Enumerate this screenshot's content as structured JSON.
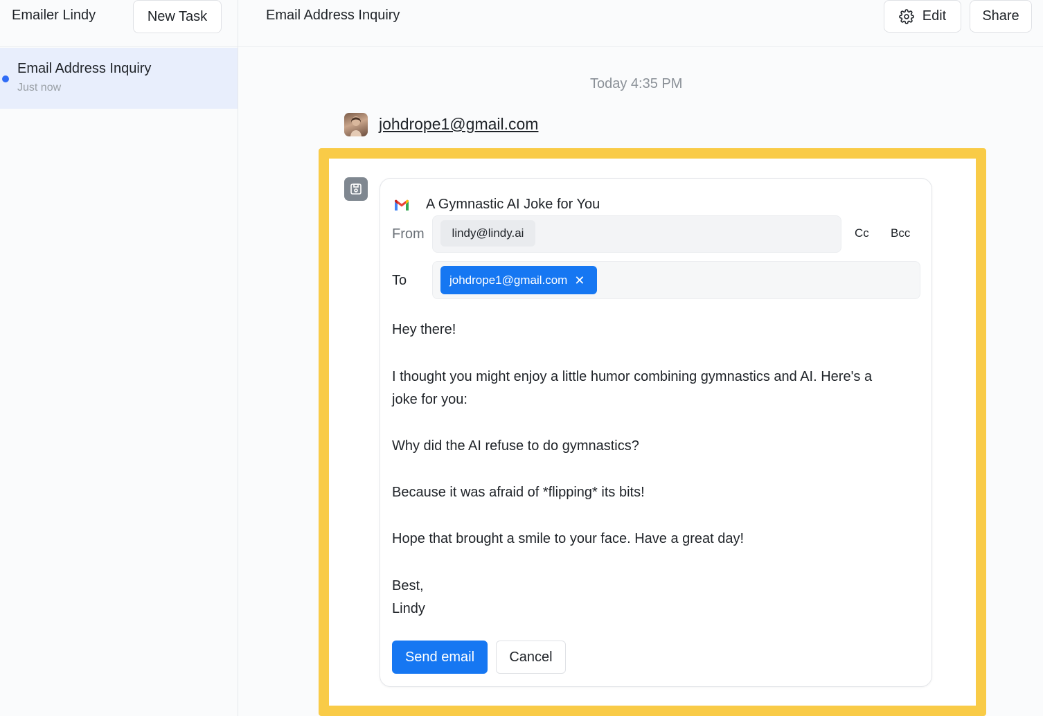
{
  "sidebar": {
    "app_name": "Emailer Lindy",
    "new_task_label": "New Task",
    "tasks": [
      {
        "title": "Email Address Inquiry",
        "subtitle": "Just now"
      }
    ]
  },
  "header": {
    "title": "Email Address Inquiry",
    "edit_label": "Edit",
    "share_label": "Share"
  },
  "conversation": {
    "timestamp": "Today 4:35 PM",
    "sender_email": "johdrope1@gmail.com"
  },
  "draft": {
    "subject": "A Gymnastic AI Joke for You",
    "from_label": "From",
    "from_value": "lindy@lindy.ai",
    "cc_label": "Cc",
    "bcc_label": "Bcc",
    "to_label": "To",
    "to_value": "johdrope1@gmail.com",
    "body": [
      "Hey there!",
      "I thought you might enjoy a little humor combining gymnastics and AI. Here's a",
      "joke for you:",
      "Why did the AI refuse to do gymnastics?",
      "Because it was afraid of *flipping* its bits!",
      "Hope that brought a smile to your face. Have a great day!",
      "Best,",
      "Lindy"
    ],
    "send_label": "Send email",
    "cancel_label": "Cancel"
  },
  "colors": {
    "accent": "#1677f2",
    "highlight": "#f9cb47",
    "selected_task_bg": "#e8eefc"
  }
}
